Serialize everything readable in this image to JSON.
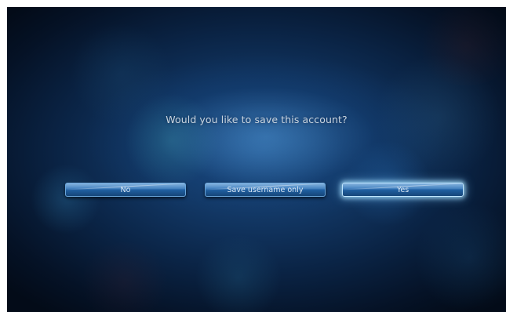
{
  "dialog": {
    "question": "Would you like to save this account?",
    "buttons": {
      "no_label": "No",
      "save_username_label": "Save username only",
      "yes_label": "Yes"
    },
    "focused_button": "Yes"
  },
  "colors": {
    "background": "#0b2546",
    "button": "#2a6aae",
    "focus_glow": "#bfe6ff",
    "text": "#c9d4df"
  }
}
